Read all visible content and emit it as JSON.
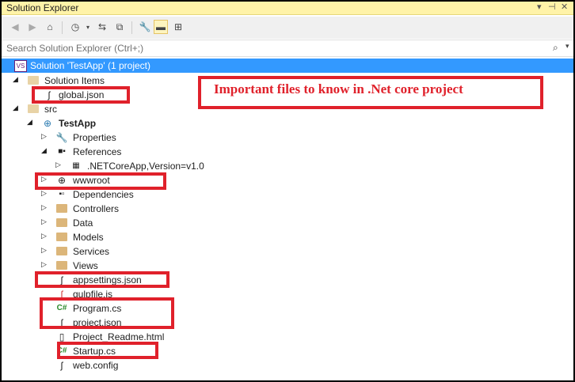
{
  "window": {
    "title": "Solution Explorer"
  },
  "search": {
    "placeholder": "Search Solution Explorer (Ctrl+;)"
  },
  "solution": {
    "label": "Solution 'TestApp' (1 project)"
  },
  "callout": "Important files to know in .Net core project",
  "tree": {
    "solution_items": "Solution Items",
    "global_json": "global.json",
    "src": "src",
    "project": "TestApp",
    "properties": "Properties",
    "references": "References",
    "netcoreapp": ".NETCoreApp,Version=v1.0",
    "wwwroot": "wwwroot",
    "dependencies": "Dependencies",
    "controllers": "Controllers",
    "data": "Data",
    "models": "Models",
    "services": "Services",
    "views": "Views",
    "appsettings": "appsettings.json",
    "gulpfile": "gulpfile.js",
    "program": "Program.cs",
    "project_json": "project.json",
    "readme": "Project_Readme.html",
    "startup": "Startup.cs",
    "webconfig": "web.config"
  },
  "colors": {
    "selection": "#3399ff",
    "highlight": "#e0212b",
    "titlebar": "#fff3a8"
  }
}
